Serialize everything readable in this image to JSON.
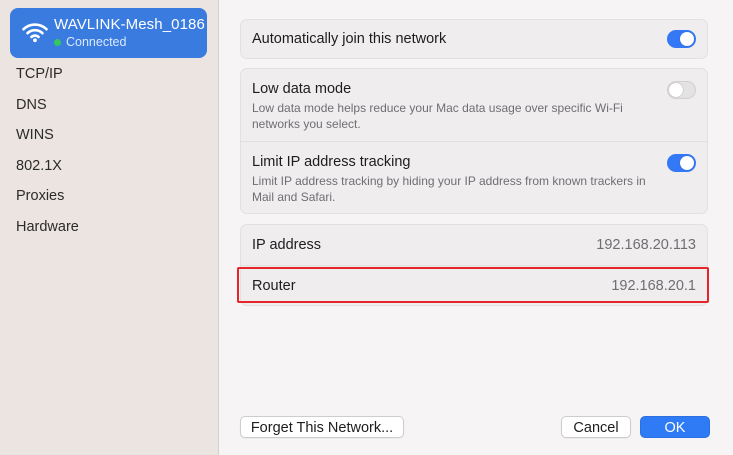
{
  "network": {
    "name": "WAVLINK-Mesh_0186",
    "status": "Connected",
    "icon": "wifi-icon"
  },
  "sidebar": {
    "items": [
      {
        "label": "TCP/IP"
      },
      {
        "label": "DNS"
      },
      {
        "label": "WINS"
      },
      {
        "label": "802.1X"
      },
      {
        "label": "Proxies"
      },
      {
        "label": "Hardware"
      }
    ]
  },
  "settings": {
    "auto_join": {
      "label": "Automatically join this network",
      "enabled": true
    },
    "low_data": {
      "label": "Low data mode",
      "description": "Low data mode helps reduce your Mac data usage over specific Wi-Fi networks you select.",
      "enabled": false
    },
    "limit_ip": {
      "label": "Limit IP address tracking",
      "description": "Limit IP address tracking by hiding your IP address from known trackers in Mail and Safari.",
      "enabled": true
    }
  },
  "info": {
    "ip_label": "IP address",
    "ip_value": "192.168.20.113",
    "router_label": "Router",
    "router_value": "192.168.20.1"
  },
  "buttons": {
    "forget": "Forget This Network...",
    "cancel": "Cancel",
    "ok": "OK"
  },
  "colors": {
    "accent": "#3478f6",
    "highlight": "#e4262b",
    "connected": "#34c759"
  }
}
